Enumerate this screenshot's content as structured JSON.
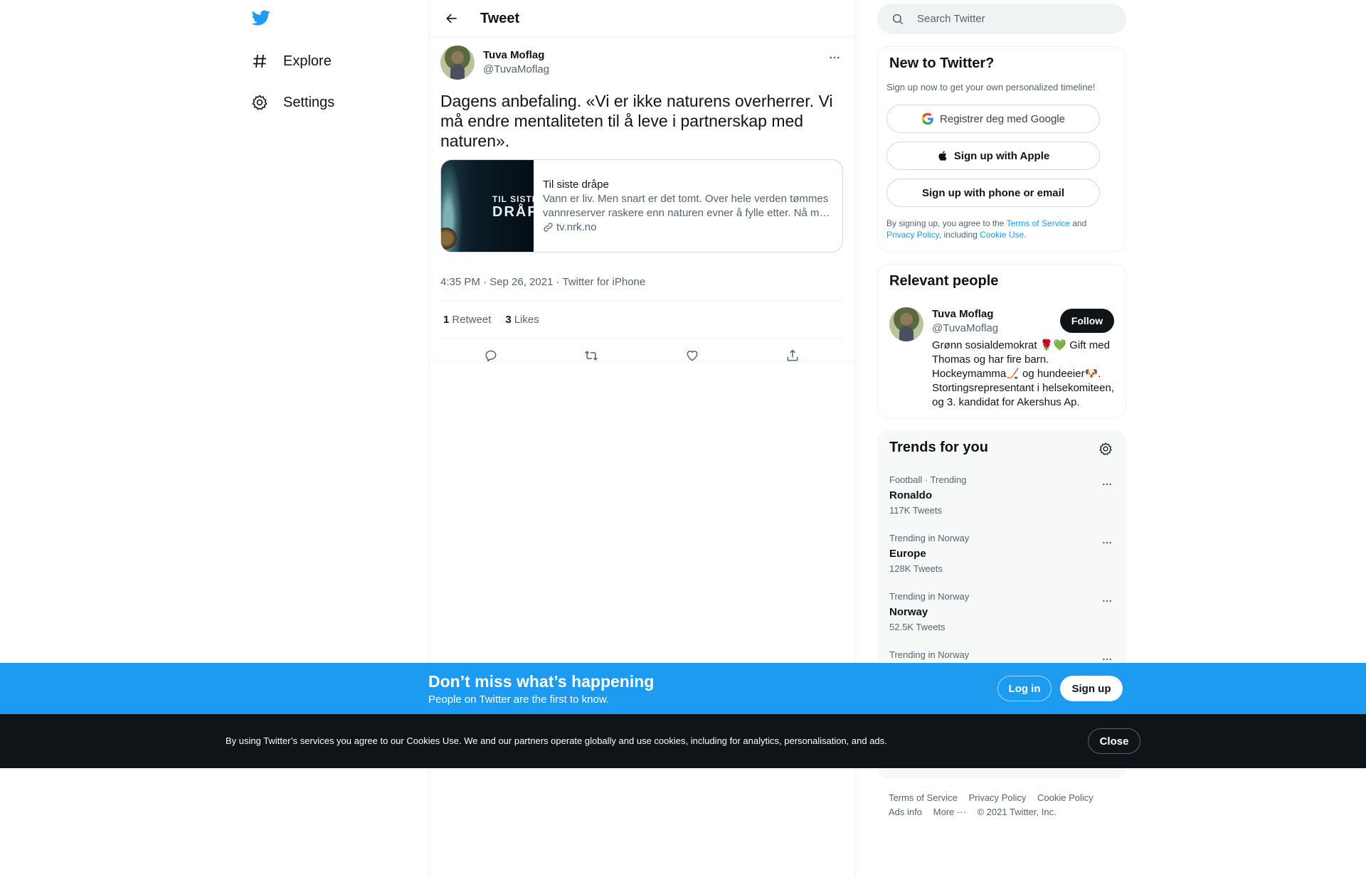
{
  "nav": {
    "items": [
      {
        "label": "Explore",
        "icon": "hashtag-icon"
      },
      {
        "label": "Settings",
        "icon": "gear-icon"
      }
    ]
  },
  "header": {
    "title": "Tweet"
  },
  "tweet": {
    "author_name": "Tuva Moflag",
    "author_handle": "@TuvaMoflag",
    "text": "Dagens anbefaling. «Vi er ikke naturens overherrer. Vi må endre mentaliteten til å leve i partnerskap med naturen».",
    "card": {
      "image_line1": "TIL SISTE",
      "image_line2": "DRÅPE",
      "title": "Til siste dråpe",
      "description": "Vann er liv. Men snart er det tomt. Over hele verden tømmes vannreserver raskere enn naturen evner å fylle etter. Nå må …",
      "domain": "tv.nrk.no"
    },
    "meta": "4:35 PM · Sep 26, 2021 · Twitter for iPhone",
    "retweets_count": "1",
    "retweets_label": "Retweet",
    "likes_count": "3",
    "likes_label": "Likes"
  },
  "search": {
    "placeholder": "Search Twitter"
  },
  "new_to_twitter": {
    "title": "New to Twitter?",
    "subtitle": "Sign up now to get your own personalized timeline!",
    "google_label": "Registrer deg med Google",
    "apple_label": "Sign up with Apple",
    "phone_label": "Sign up with phone or email",
    "legal_1": "By signing up, you agree to the ",
    "terms": "Terms of Service",
    "legal_2": " and ",
    "privacy": "Privacy Policy",
    "legal_3": ", including ",
    "cookie": "Cookie Use",
    "legal_4": "."
  },
  "relevant_people": {
    "title": "Relevant people",
    "name": "Tuva Moflag",
    "handle": "@TuvaMoflag",
    "follow_label": "Follow",
    "bio": "Grønn sosialdemokrat 🌹💚 Gift med Thomas og har fire barn. Hockeymamma🏒 og hundeeier🐶. Stortingsrepresentant i helsekomiteen, og 3. kandidat for Akershus Ap."
  },
  "trends": {
    "title": "Trends for you",
    "items": [
      {
        "context": "Football · Trending",
        "name": "Ronaldo",
        "count": "117K Tweets"
      },
      {
        "context": "Trending in Norway",
        "name": "Europe",
        "count": "128K Tweets"
      },
      {
        "context": "Trending in Norway",
        "name": "Norway",
        "count": "52.5K Tweets"
      },
      {
        "context": "Trending in Norway",
        "name": "",
        "count": ""
      }
    ]
  },
  "footer": {
    "terms": "Terms of Service",
    "privacy": "Privacy Policy",
    "cookie": "Cookie Policy",
    "ads": "Ads info",
    "more": "More ···",
    "copyright": "© 2021 Twitter, Inc."
  },
  "signup_bar": {
    "title": "Don’t miss what’s happening",
    "subtitle": "People on Twitter are the first to know.",
    "login_label": "Log in",
    "signup_label": "Sign up"
  },
  "cookie_bar": {
    "text": "By using Twitter’s services you agree to our Cookies Use. We and our partners operate globally and use cookies, including for analytics, personalisation, and ads.",
    "close_label": "Close"
  },
  "colors": {
    "accent": "#1d9bf0",
    "text": "#0f1419",
    "secondary": "#536471",
    "cookie_bg": "#0f1419"
  }
}
